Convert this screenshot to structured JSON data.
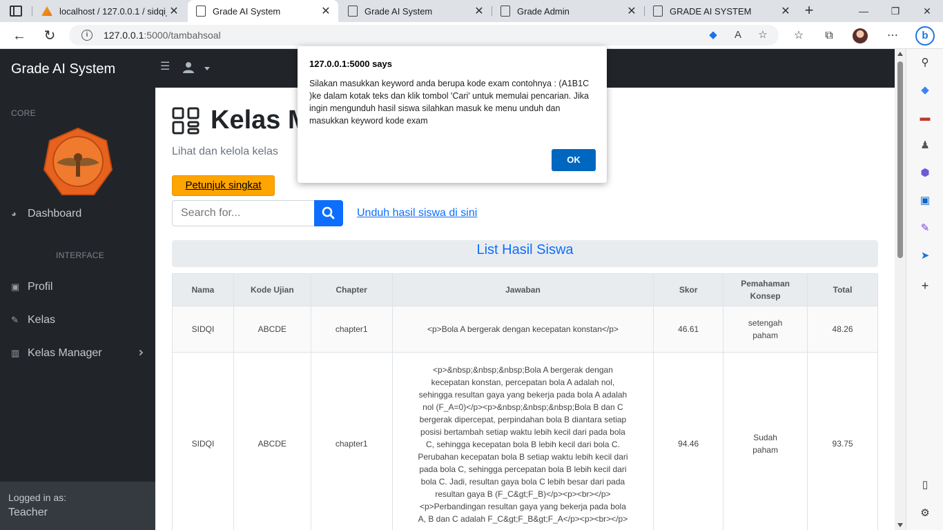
{
  "browser": {
    "tabs": [
      {
        "title": "localhost / 127.0.0.1 / sidqi_dl",
        "active": false
      },
      {
        "title": "Grade AI System",
        "active": true
      },
      {
        "title": "Grade AI System",
        "active": false
      },
      {
        "title": "Grade Admin",
        "active": false
      },
      {
        "title": "GRADE AI SYSTEM",
        "active": false
      }
    ],
    "url_host": "127.0.0.1",
    "url_rest": ":5000/tambahsoal"
  },
  "app": {
    "brand": "Grade AI System"
  },
  "sidebar": {
    "heading_core": "CORE",
    "heading_interface": "INTERFACE",
    "items": [
      {
        "label": "Dashboard",
        "icon": "dashboard-icon"
      },
      {
        "label": "Profil",
        "icon": "profile-card-icon"
      },
      {
        "label": "Kelas",
        "icon": "edit-icon"
      },
      {
        "label": "Kelas Manager",
        "icon": "columns-icon"
      }
    ],
    "footer_small": "Logged in as:",
    "footer_user": "Teacher"
  },
  "main": {
    "title": "Kelas M",
    "subtitle": "Lihat dan kelola kelas",
    "petunjuk_label": "Petunjuk singkat",
    "search_placeholder": "Search for...",
    "unduh_label": "Unduh hasil siswa di sini",
    "list_title": "List Hasil Siswa",
    "table": {
      "headers": [
        "Nama",
        "Kode Ujian",
        "Chapter",
        "Jawaban",
        "Skor",
        "Pemahaman Konsep",
        "Total"
      ],
      "rows": [
        {
          "nama": "SIDQI",
          "kode": "ABCDE",
          "chapter": "chapter1",
          "jawaban": "<p>Bola A bergerak dengan kecepatan konstan</p>",
          "skor": "46.61",
          "pemahaman": "setengah paham",
          "total": "48.26"
        },
        {
          "nama": "SIDQI",
          "kode": "ABCDE",
          "chapter": "chapter1",
          "jawaban": "<p>&nbsp;&nbsp;&nbsp;Bola A bergerak dengan kecepatan konstan, percepatan bola A adalah nol, sehingga resultan gaya yang bekerja pada bola A adalah nol (F_A=0)</p><p>&nbsp;&nbsp;&nbsp;Bola B dan C bergerak dipercepat, perpindahan bola B diantara setiap posisi bertambah setiap waktu lebih kecil dari pada bola C, sehingga kecepatan bola B lebih kecil dari bola C. Perubahan kecepatan bola B setiap waktu lebih kecil dari pada bola C, sehingga percepatan bola B lebih kecil dari bola C. Jadi, resultan gaya bola C lebih besar dari pada resultan gaya B (F_C&gt;F_B)</p><p><br></p><p>Perbandingan resultan gaya yang bekerja pada bola A, B dan C adalah F_C&gt;F_B&gt;F_A</p><p><br></p>",
          "skor": "94.46",
          "pemahaman": "Sudah paham",
          "total": "93.75"
        }
      ]
    }
  },
  "dialog": {
    "title": "127.0.0.1:5000 says",
    "message": "Silakan masukkan keyword anda berupa kode exam contohnya : (A1B1C )ke dalam kotak teks dan klik tombol 'Cari' untuk memulai pencarian. Jika ingin mengunduh hasil siswa silahkan masuk ke menu unduh dan masukkan keyword kode exam",
    "ok_label": "OK"
  },
  "colors": {
    "sidebar_bg": "#212529",
    "accent": "#0d6efd",
    "petunjuk_bg": "#ffa500",
    "dialog_ok": "#0067c0"
  }
}
